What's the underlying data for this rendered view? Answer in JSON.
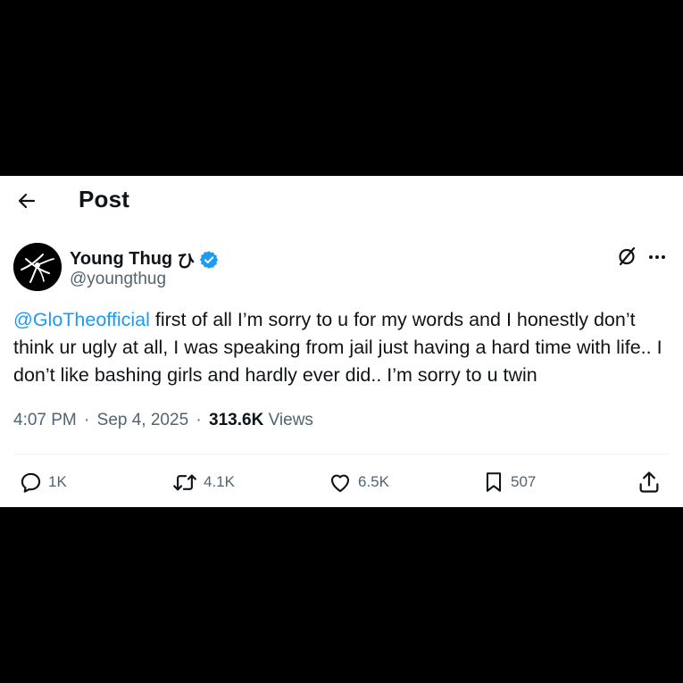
{
  "header": {
    "title": "Post"
  },
  "author": {
    "display_name": "Young Thug",
    "name_emoji": "ひ",
    "handle": "@youngthug"
  },
  "tweet": {
    "mention": "@GloTheofficial",
    "text": " first of all I’m sorry to u for my words and I honestly don’t think ur ugly at all, I was speaking from jail just having a hard time with life.. I don’t like bashing girls and hardly ever did.. I’m sorry to u twin"
  },
  "meta": {
    "time": "4:07 PM",
    "separator": "·",
    "date": "Sep 4, 2025",
    "views_count": "313.6K",
    "views_label": "Views"
  },
  "actions": {
    "replies": "1K",
    "reposts": "4.1K",
    "likes": "6.5K",
    "bookmarks": "507"
  },
  "colors": {
    "accent": "#1d9bf0",
    "text": "#0f1419",
    "secondary": "#536471"
  },
  "icons": [
    "back-arrow-icon",
    "verified-badge-icon",
    "grok-icon",
    "more-icon",
    "reply-icon",
    "repost-icon",
    "like-icon",
    "bookmark-icon",
    "share-icon"
  ]
}
